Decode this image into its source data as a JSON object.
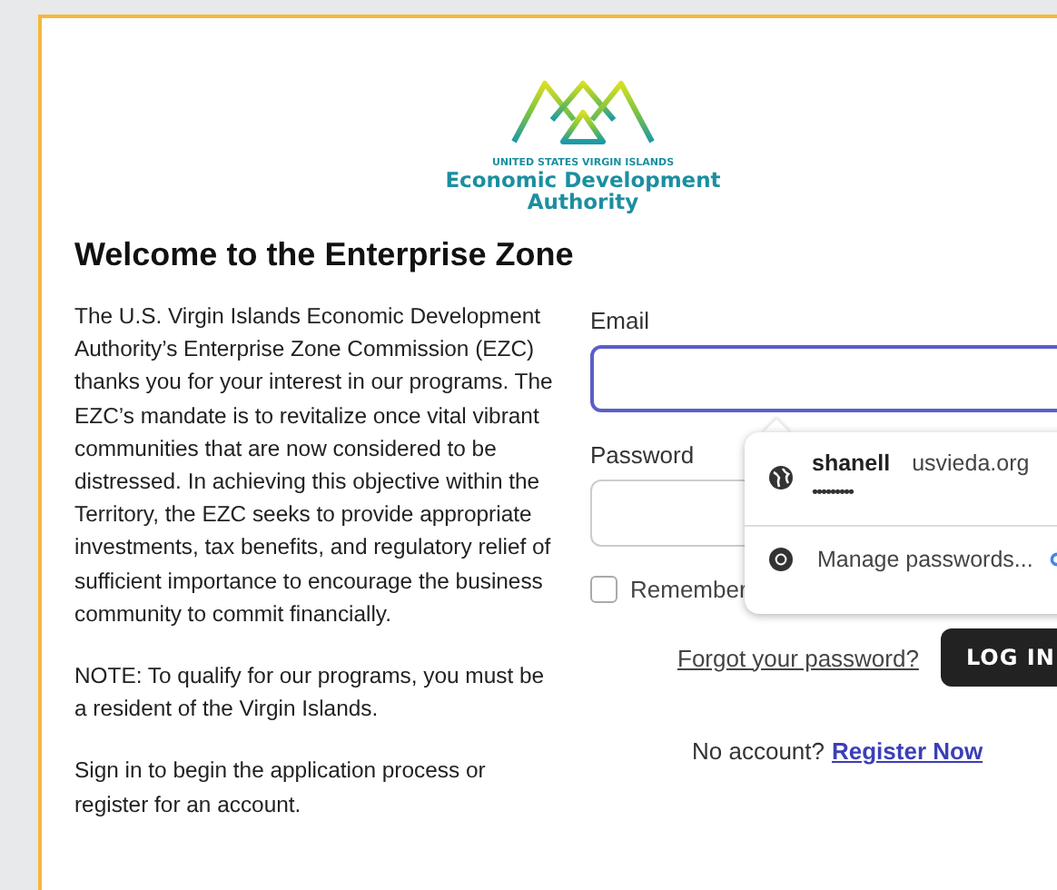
{
  "logo": {
    "tagline": "UNITED STATES VIRGIN ISLANDS",
    "name_line_1": "Economic Development",
    "name_line_2": "Authority"
  },
  "heading": "Welcome to the Enterprise Zone",
  "paragraphs": [
    "The U.S. Virgin Islands Economic Development Authority’s Enterprise Zone Commission (EZC) thanks you for your interest in our programs. The EZC’s mandate is to revitalize once vital vibrant communities that are now considered to be distressed. In achieving this objective within the Territory, the EZC seeks to provide appropriate investments, tax benefits, and regulatory relief of sufficient importance to encourage the business community to commit financially.",
    "NOTE: To qualify for our programs, you must be a resident of the Virgin Islands.",
    "Sign in to begin the application process or register for an account."
  ],
  "form": {
    "email_label": "Email",
    "email_focused": true,
    "password_label": "Password",
    "remember_label": "Remember",
    "remember_checked": false,
    "forgot_link": "Forgot your password?",
    "login_button": "LOG IN",
    "no_account_text": "No account?",
    "register_link": "Register Now"
  },
  "autofill_popup": {
    "username": "shanell",
    "site": "usvieda.org",
    "password_mask": "•••••••••",
    "manage_label": "Manage passwords..."
  }
}
